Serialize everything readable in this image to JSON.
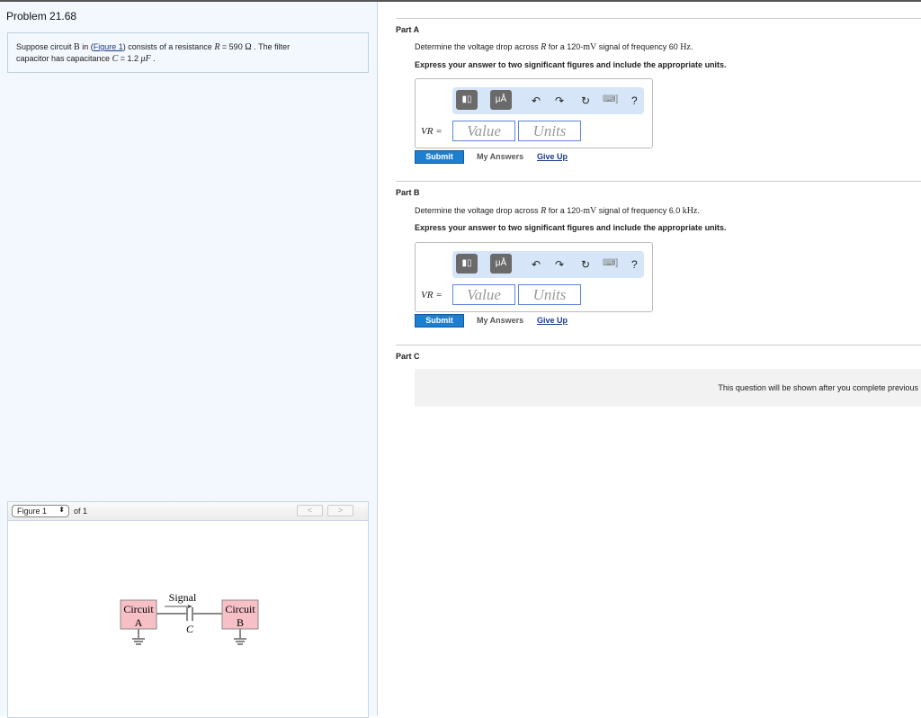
{
  "problem": {
    "title": "Problem 21.68",
    "intro": {
      "t1": "Suppose circuit ",
      "B": "B",
      "t2": " in (",
      "link": "Figure 1",
      "t3": ") consists of a resistance ",
      "R": "R",
      "t4": " = 590  ",
      "ohm": "Ω",
      "t5": " . The filter",
      "t6": "capacitor has capacitance ",
      "C": "C",
      "t7": " = 1.2  ",
      "uF": "μF",
      "t8": " ."
    }
  },
  "figure": {
    "selector": "Figure 1",
    "of": "of 1",
    "prev": "<",
    "next": ">",
    "circuit_a": [
      "Circuit",
      "A"
    ],
    "circuit_b": [
      "Circuit",
      "B"
    ],
    "signal": "Signal",
    "cap": "C"
  },
  "parts": [
    {
      "label": "Part A",
      "q1": "Determine the voltage drop across ",
      "R": "R",
      "q2": " for a 120-",
      "mV": "mV",
      "q3": " signal of frequency 60 ",
      "unit": "Hz",
      "q4": ".",
      "instr": "Express your answer to two significant figures and include the appropriate units.",
      "var": "VR =",
      "value_ph": "Value",
      "units_ph": "Units",
      "submit": "Submit",
      "my": "My Answers",
      "giveup": "Give Up"
    },
    {
      "label": "Part B",
      "q1": "Determine the voltage drop across ",
      "R": "R",
      "q2": " for a 120-",
      "mV": "mV",
      "q3": " signal of frequency 6.0 ",
      "unit": "kHz",
      "q4": ".",
      "instr": "Express your answer to two significant figures and include the appropriate units.",
      "var": "VR =",
      "value_ph": "Value",
      "units_ph": "Units",
      "submit": "Submit",
      "my": "My Answers",
      "giveup": "Give Up"
    },
    {
      "label": "Part C",
      "locked": "This question will be shown after you complete previous"
    }
  ],
  "toolbar": {
    "template": "template-icon",
    "units": "μÅ",
    "undo": "↶",
    "redo": "↷",
    "reset": "↻",
    "keyboard": "⌨]",
    "help": "?"
  }
}
